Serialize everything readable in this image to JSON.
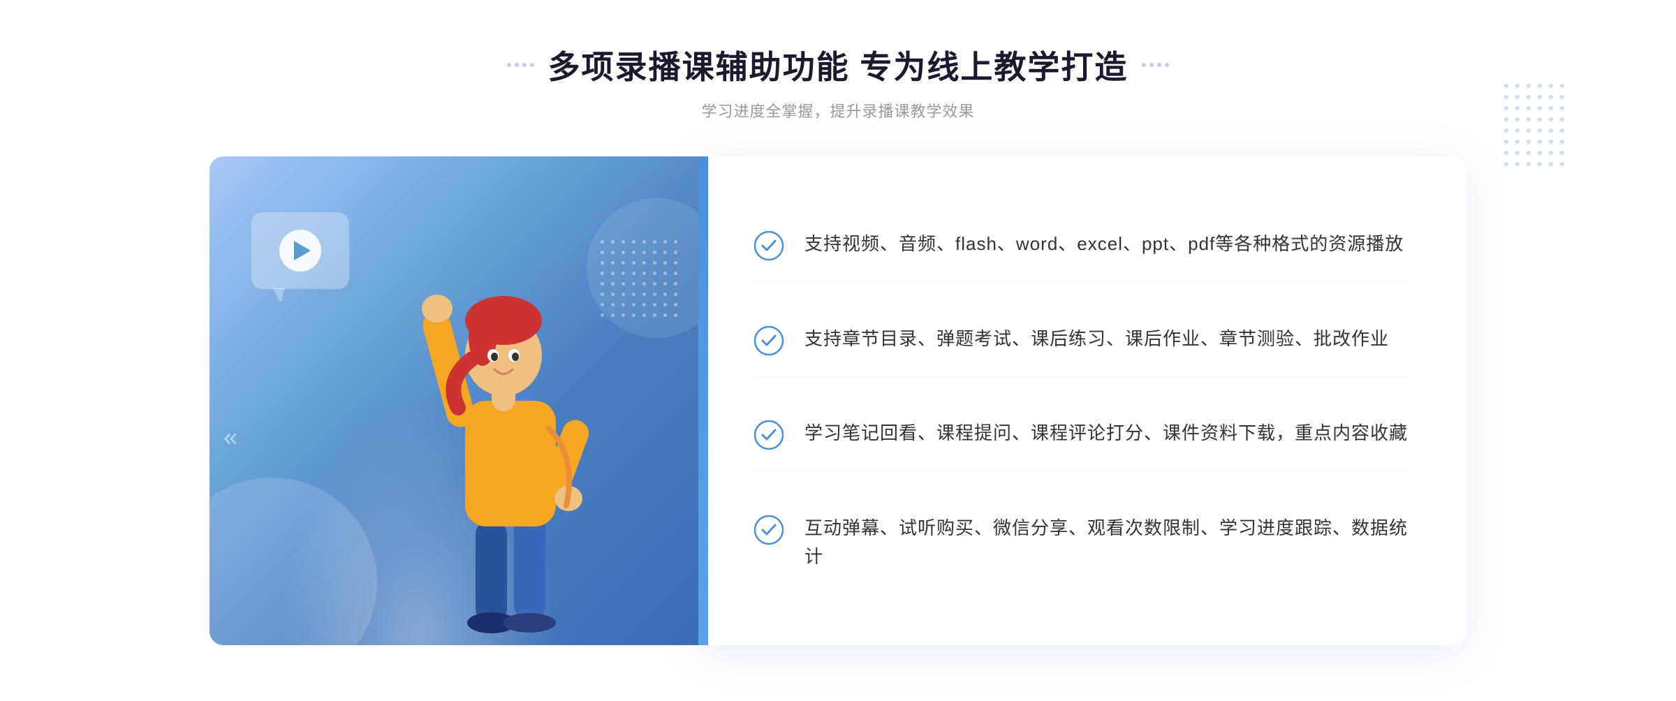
{
  "header": {
    "title": "多项录播课辅助功能 专为线上教学打造",
    "subtitle": "学习进度全掌握，提升录播课教学效果",
    "left_dots_aria": "decoration-dots-left",
    "right_dots_aria": "decoration-dots-right"
  },
  "features": [
    {
      "id": 1,
      "text": "支持视频、音频、flash、word、excel、ppt、pdf等各种格式的资源播放"
    },
    {
      "id": 2,
      "text": "支持章节目录、弹题考试、课后练习、课后作业、章节测验、批改作业"
    },
    {
      "id": 3,
      "text": "学习笔记回看、课程提问、课程评论打分、课件资料下载，重点内容收藏"
    },
    {
      "id": 4,
      "text": "互动弹幕、试听购买、微信分享、观看次数限制、学习进度跟踪、数据统计"
    }
  ],
  "illustration": {
    "play_button_aria": "play-button",
    "character_aria": "teaching-character"
  },
  "decorations": {
    "chevron_symbol": "«",
    "chevron_right_symbol": "»"
  },
  "colors": {
    "brand_blue": "#4a90d9",
    "light_blue": "#a8c8f8",
    "dark_text": "#1a1a2e",
    "gray_text": "#999999",
    "body_text": "#333333"
  }
}
